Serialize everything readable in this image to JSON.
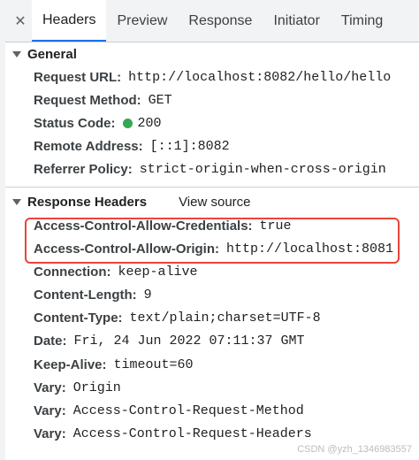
{
  "tabs": [
    "Headers",
    "Preview",
    "Response",
    "Initiator",
    "Timing"
  ],
  "active_tab": "Headers",
  "general": {
    "title": "General",
    "rows": [
      {
        "key": "Request URL:",
        "value": "http://localhost:8082/hello/hello"
      },
      {
        "key": "Request Method:",
        "value": "GET"
      },
      {
        "key": "Status Code:",
        "value": "200"
      },
      {
        "key": "Remote Address:",
        "value": "[::1]:8082"
      },
      {
        "key": "Referrer Policy:",
        "value": "strict-origin-when-cross-origin"
      }
    ]
  },
  "response_headers": {
    "title": "Response Headers",
    "view_source": "View source",
    "rows": [
      {
        "key": "Access-Control-Allow-Credentials:",
        "value": "true"
      },
      {
        "key": "Access-Control-Allow-Origin:",
        "value": "http://localhost:8081"
      },
      {
        "key": "Connection:",
        "value": "keep-alive"
      },
      {
        "key": "Content-Length:",
        "value": "9"
      },
      {
        "key": "Content-Type:",
        "value": "text/plain;charset=UTF-8"
      },
      {
        "key": "Date:",
        "value": "Fri, 24 Jun 2022 07:11:37 GMT"
      },
      {
        "key": "Keep-Alive:",
        "value": "timeout=60"
      },
      {
        "key": "Vary:",
        "value": "Origin"
      },
      {
        "key": "Vary:",
        "value": "Access-Control-Request-Method"
      },
      {
        "key": "Vary:",
        "value": "Access-Control-Request-Headers"
      }
    ]
  },
  "status_color": "#34a853",
  "highlight_color": "#e8453c",
  "watermark": "CSDN @yzh_1346983557"
}
